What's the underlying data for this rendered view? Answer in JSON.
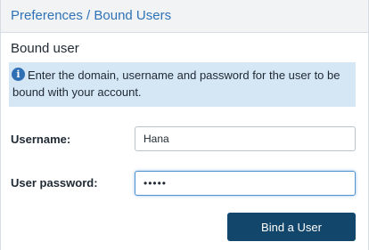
{
  "header": {
    "title": "Preferences / Bound Users"
  },
  "section": {
    "title": "Bound user"
  },
  "info": {
    "icon": "info-icon",
    "icon_glyph": "i",
    "text": "Enter the domain, username and password for the user to be bound with your account."
  },
  "form": {
    "username": {
      "label": "Username:",
      "value": "Hana"
    },
    "password": {
      "label": "User password:",
      "value": "hanaa"
    }
  },
  "actions": {
    "bind_label": "Bind a User"
  },
  "colors": {
    "header_text": "#2f73b6",
    "info_background": "#d5e6f5",
    "primary_button": "#12466b",
    "focus_border": "#4f93d2"
  }
}
